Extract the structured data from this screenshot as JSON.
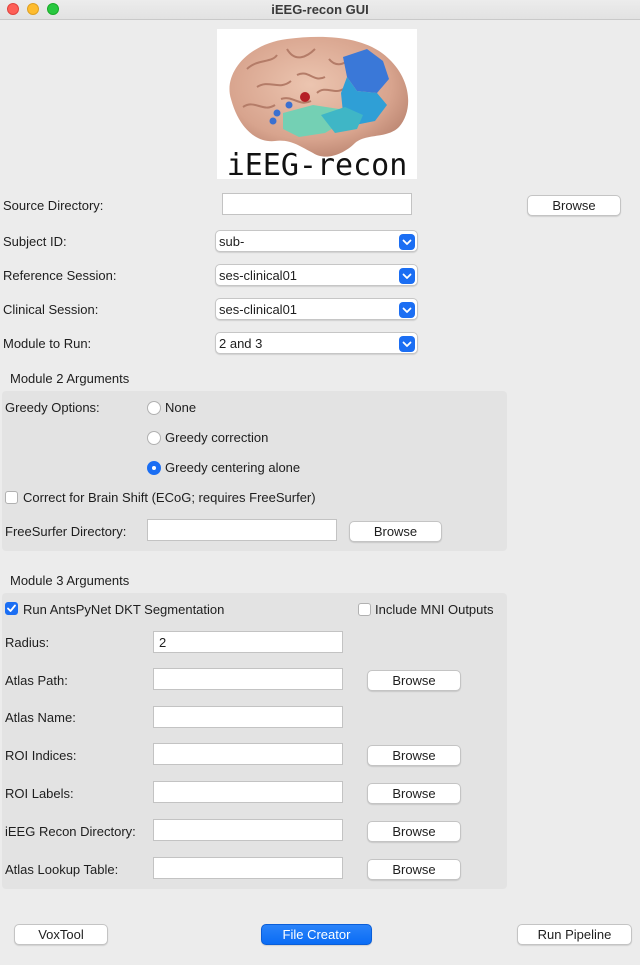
{
  "window": {
    "title": "iEEG-recon GUI"
  },
  "logo": {
    "text": "iEEG-recon"
  },
  "fields": {
    "source_directory": {
      "label": "Source Directory:",
      "value": ""
    },
    "subject_id": {
      "label": "Subject ID:",
      "value": "sub-"
    },
    "reference_session": {
      "label": "Reference Session:",
      "value": "ses-clinical01"
    },
    "clinical_session": {
      "label": "Clinical Session:",
      "value": "ses-clinical01"
    },
    "module_to_run": {
      "label": "Module to Run:",
      "value": "2 and 3"
    }
  },
  "browse_label": "Browse",
  "module2": {
    "title": "Module 2 Arguments",
    "greedy_label": "Greedy Options:",
    "options": [
      {
        "label": "None",
        "selected": false
      },
      {
        "label": "Greedy correction",
        "selected": false
      },
      {
        "label": "Greedy centering alone",
        "selected": true
      }
    ],
    "brain_shift": {
      "label": "Correct for Brain Shift (ECoG; requires FreeSurfer)",
      "checked": false
    },
    "freesurfer_dir": {
      "label": "FreeSurfer Directory:",
      "value": ""
    }
  },
  "module3": {
    "title": "Module 3 Arguments",
    "antspynet": {
      "label": "Run AntsPyNet DKT Segmentation",
      "checked": true
    },
    "mni": {
      "label": "Include MNI Outputs",
      "checked": false
    },
    "radius": {
      "label": "Radius:",
      "value": "2"
    },
    "atlas_path": {
      "label": "Atlas Path:",
      "value": ""
    },
    "atlas_name": {
      "label": "Atlas Name:",
      "value": ""
    },
    "roi_indices": {
      "label": "ROI Indices:",
      "value": ""
    },
    "roi_labels": {
      "label": "ROI Labels:",
      "value": ""
    },
    "ieeg_recon_dir": {
      "label": "iEEG Recon Directory:",
      "value": ""
    },
    "atlas_lookup": {
      "label": "Atlas Lookup Table:",
      "value": ""
    }
  },
  "footer": {
    "voxtool": "VoxTool",
    "file_creator": "File Creator",
    "run_pipeline": "Run Pipeline"
  },
  "colors": {
    "accent": "#1b6ef3",
    "window_bg": "#ececec",
    "group_bg": "#e3e3e3"
  }
}
